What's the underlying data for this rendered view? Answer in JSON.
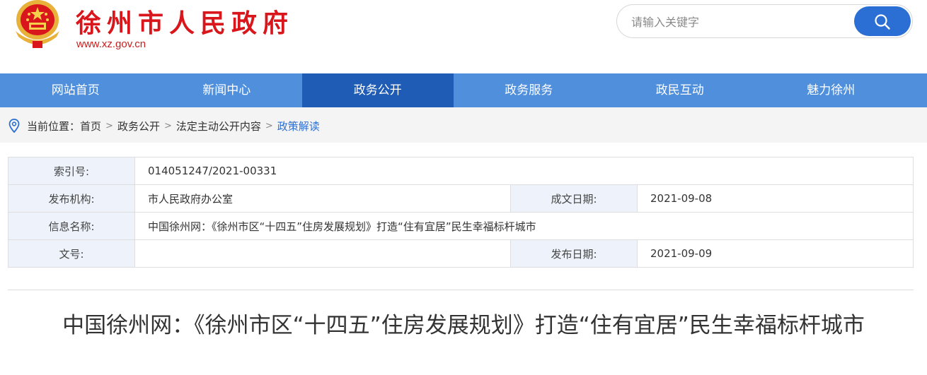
{
  "header": {
    "site_title": "徐州市人民政府",
    "site_url": "www.xz.gov.cn",
    "emblem_icon": "national-emblem-icon"
  },
  "search": {
    "placeholder": "请输入关键字",
    "value": ""
  },
  "nav": {
    "items": [
      {
        "label": "网站首页"
      },
      {
        "label": "新闻中心"
      },
      {
        "label": "政务公开"
      },
      {
        "label": "政务服务"
      },
      {
        "label": "政民互动"
      },
      {
        "label": "魅力徐州"
      }
    ],
    "active": "政务公开",
    "bar_color": "#4f8fdc",
    "active_color": "#1f5cb5"
  },
  "breadcrumb": {
    "prefix": "当前位置：",
    "items": [
      "首页",
      "政务公开",
      "法定主动公开内容",
      "政策解读"
    ],
    "separator": ">"
  },
  "info": {
    "index_label": "索引号:",
    "index_value": "014051247/2021-00331",
    "org_label": "发布机构:",
    "org_value": "市人民政府办公室",
    "created_label": "成文日期:",
    "created_value": "2021-09-08",
    "name_label": "信息名称:",
    "name_value": "中国徐州网：《徐州市区“十四五”住房发展规划》打造“住有宜居”民生幸福标杆城市",
    "doc_no_label": "文号:",
    "doc_no_value": "",
    "published_label": "发布日期:",
    "published_value": "2021-09-09"
  },
  "article": {
    "title": "中国徐州网：《徐州市区“十四五”住房发展规划》打造“住有宜居”民生幸福标杆城市"
  }
}
